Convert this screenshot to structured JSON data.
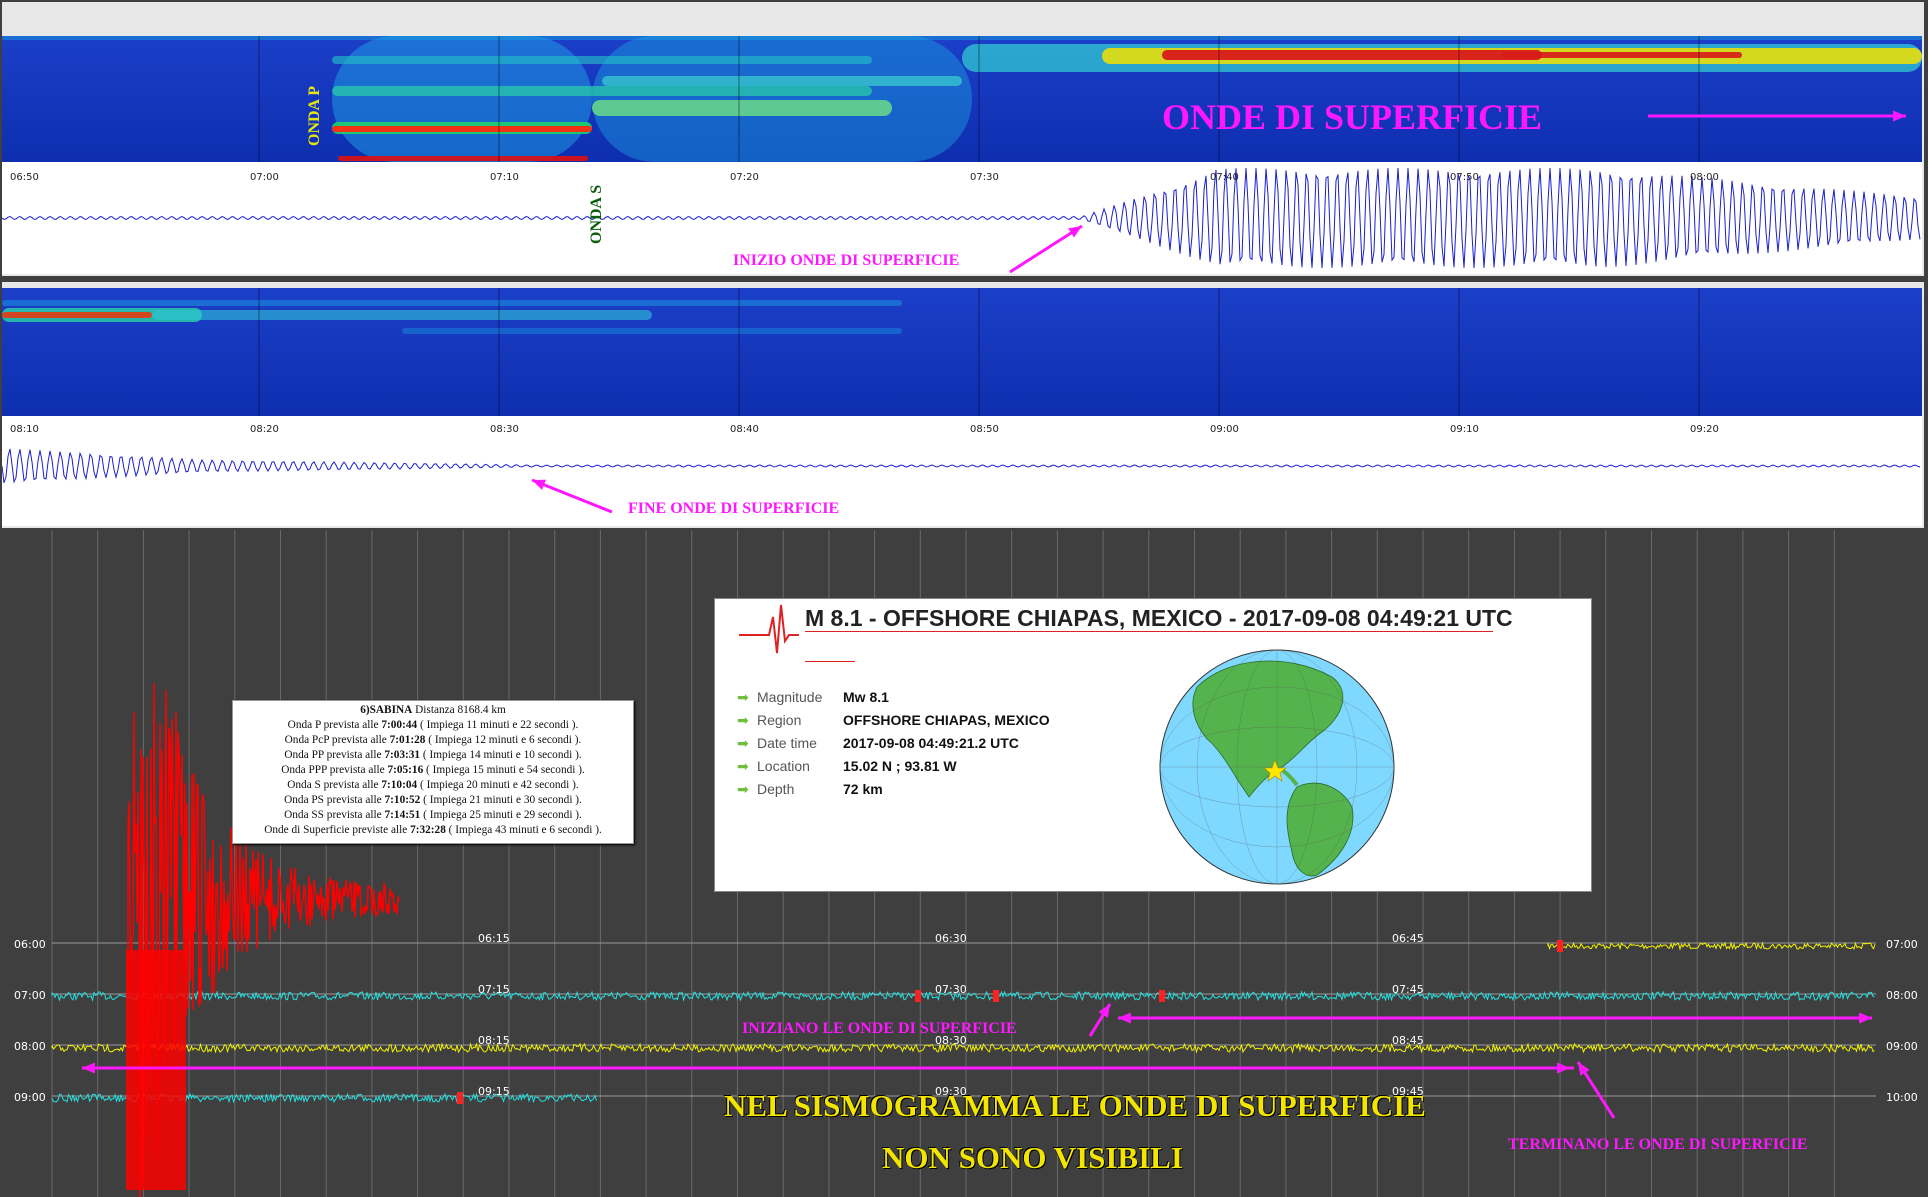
{
  "colors": {
    "magenta": "#ff18ff",
    "cyan_trace": "#24e0e0",
    "yellow_trace": "#f2f200",
    "red_trace": "#ff0000",
    "spectrogram_bg": "#1c3fc9",
    "trace_blue": "#1a1fd0"
  },
  "top_panel": {
    "ticks": [
      "06:50",
      "07:00",
      "07:10",
      "07:20",
      "07:30",
      "07:40",
      "07:50",
      "08:00"
    ],
    "label_p": "ONDA P",
    "label_s": "ONDA S",
    "title": "ONDE DI SUPERFICIE",
    "arrow_label": "INIZIO ONDE DI SUPERFICIE"
  },
  "middle_panel": {
    "ticks": [
      "08:10",
      "08:20",
      "08:30",
      "08:40",
      "08:50",
      "09:00",
      "09:10",
      "09:20"
    ],
    "arrow_label": "FINE ONDE DI SUPERFICIE"
  },
  "info_box": {
    "station": "6)SABINA",
    "distance": "Distanza 8168.4 km",
    "lines": [
      {
        "prefix": "Onda P prevista alle ",
        "time": "7:00:44",
        "suffix": " ( Impiega 11 minuti e 22 secondi )."
      },
      {
        "prefix": "Onda PcP prevista alle ",
        "time": "7:01:28",
        "suffix": " ( Impiega 12 minuti e 6 secondi )."
      },
      {
        "prefix": "Onda PP prevista alle ",
        "time": "7:03:31",
        "suffix": " ( Impiega 14 minuti e 10 secondi )."
      },
      {
        "prefix": "Onda PPP prevista alle ",
        "time": "7:05:16",
        "suffix": " ( Impiega 15 minuti e 54 secondi )."
      },
      {
        "prefix": "Onda S prevista alle ",
        "time": "7:10:04",
        "suffix": " ( Impiega 20 minuti e 42 secondi )."
      },
      {
        "prefix": "Onda PS prevista alle ",
        "time": "7:10:52",
        "suffix": " ( Impiega 21 minuti e 30 secondi )."
      },
      {
        "prefix": "Onda SS prevista alle ",
        "time": "7:14:51",
        "suffix": " ( Impiega 25 minuti e 29 secondi )."
      },
      {
        "prefix": "Onde di Superficie previste alle ",
        "time": "7:32:28",
        "suffix": " ( Impiega 43 minuti e 6 secondi )."
      }
    ]
  },
  "quake": {
    "title": "M 8.1 - OFFSHORE CHIAPAS, MEXICO - 2017-09-08 04:49:21 UTC",
    "rows": [
      {
        "key": "Magnitude",
        "value": "Mw 8.1"
      },
      {
        "key": "Region",
        "value": "OFFSHORE CHIAPAS, MEXICO"
      },
      {
        "key": "Date time",
        "value": "2017-09-08 04:49:21.2 UTC"
      },
      {
        "key": "Location",
        "value": "15.02 N ; 93.81 W"
      },
      {
        "key": "Depth",
        "value": "72 km"
      }
    ]
  },
  "helicorder": {
    "left_labels": [
      "06:00",
      "07:00",
      "08:00",
      "09:00"
    ],
    "right_labels": [
      "07:00",
      "08:00",
      "09:00",
      "10:00"
    ],
    "row1_ticks": [
      "06:15",
      "06:30",
      "06:45"
    ],
    "row2_ticks": [
      "07:15",
      "07:30",
      "07:45"
    ],
    "row3_ticks": [
      "08:15",
      "08:30",
      "08:45"
    ],
    "row4_ticks": [
      "09:15",
      "09:30",
      "09:45"
    ],
    "start_label": "INIZIANO LE ONDE DI SUPERFICIE",
    "end_label": "TERMINANO LE ONDE DI SUPERFICIE",
    "caption_line1": "NEL SISMOGRAMMA LE ONDE DI SUPERFICIE",
    "caption_line2": "NON SONO VISIBILI"
  }
}
